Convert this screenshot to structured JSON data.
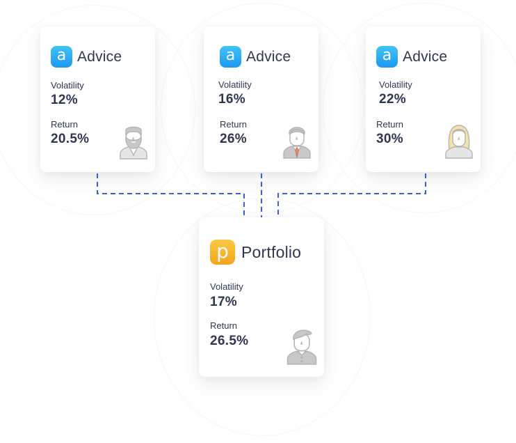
{
  "advice_cards": [
    {
      "title": "Advice",
      "icon": "a",
      "volatility_label": "Volatility",
      "volatility": "12%",
      "return_label": "Return",
      "return": "20.5%",
      "avatar": "bearded-man-avatar"
    },
    {
      "title": "Advice",
      "icon": "a",
      "volatility_label": "Volatility",
      "volatility": "16%",
      "return_label": "Return",
      "return": "26%",
      "avatar": "man-in-suit-avatar"
    },
    {
      "title": "Advice",
      "icon": "a",
      "volatility_label": "Volatility",
      "volatility": "22%",
      "return_label": "Return",
      "return": "30%",
      "avatar": "blonde-woman-avatar"
    }
  ],
  "portfolio_card": {
    "title": "Portfolio",
    "icon": "p",
    "volatility_label": "Volatility",
    "volatility": "17%",
    "return_label": "Return",
    "return": "26.5%",
    "avatar": "man-avatar"
  },
  "colors": {
    "advice_icon": "#1c98f0",
    "portfolio_icon": "#f2a51c",
    "connector": "#3d5df0",
    "text": "#2e3752",
    "avatar_gray": "#c8c8c8",
    "avatar_blonde": "#f3e2a8",
    "tie": "#e98a7a"
  }
}
